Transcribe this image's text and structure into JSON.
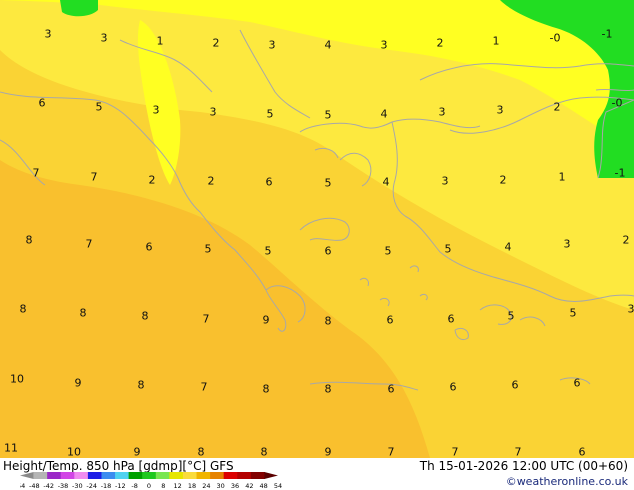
{
  "footer": {
    "title": "Height/Temp. 850 hPa [gdmp][°C] GFS",
    "datetime": "Th 15-01-2026 12:00 UTC (00+60)",
    "credit": "©weatheronline.co.uk"
  },
  "colorbar": {
    "labels": [
      "-54",
      "-48",
      "-42",
      "-38",
      "-30",
      "-24",
      "-18",
      "-12",
      "-8",
      "0",
      "8",
      "12",
      "18",
      "24",
      "30",
      "36",
      "42",
      "48",
      "54"
    ],
    "colors": [
      "#8a8a8a",
      "#b5b5b5",
      "#9b28c8",
      "#d246e6",
      "#f08cf0",
      "#1e1ee6",
      "#3c8cf0",
      "#50d2f0",
      "#00a000",
      "#1ec81e",
      "#78e650",
      "#e6e600",
      "#fadc3c",
      "#f0b400",
      "#e68200",
      "#dc0000",
      "#b40000",
      "#820000",
      "#5a0000"
    ]
  },
  "map": {
    "field_colors": {
      "cold_1": "#22dd22",
      "cold_0": "#ffff22",
      "warm_2_4": "#fde93f",
      "warm_5_7": "#fad334",
      "warm_8_10": "#f9c02e",
      "warm_11": "#f5b22a",
      "coastline": "#a8a8a8"
    },
    "values": [
      "3",
      "3",
      "1",
      "2",
      "3",
      "4",
      "3",
      "2",
      "1",
      "-0",
      "-1",
      "6",
      "5",
      "3",
      "3",
      "5",
      "5",
      "4",
      "3",
      "3",
      "2",
      "-0",
      "7",
      "7",
      "2",
      "2",
      "6",
      "5",
      "4",
      "3",
      "2",
      "1",
      "-1",
      "8",
      "7",
      "6",
      "5",
      "5",
      "6",
      "5",
      "5",
      "4",
      "3",
      "2",
      "8",
      "8",
      "8",
      "7",
      "9",
      "8",
      "6",
      "6",
      "5",
      "5",
      "3",
      "10",
      "9",
      "8",
      "7",
      "8",
      "8",
      "6",
      "6",
      "6",
      "6",
      "11",
      "10",
      "9",
      "8",
      "8",
      "9",
      "7",
      "7",
      "7",
      "6"
    ]
  }
}
